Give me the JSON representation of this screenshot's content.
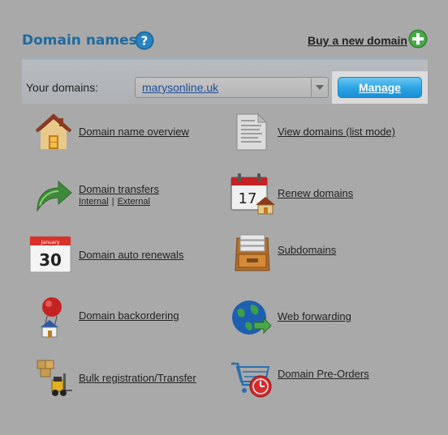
{
  "header": {
    "title": "Domain names",
    "help_icon": "question-mark-icon",
    "buy_link": "Buy a new domain",
    "buy_icon": "plus-circle-icon"
  },
  "domain_bar": {
    "label": "Your domains:",
    "selected_domain": "marysonline.uk",
    "manage_label": "Manage"
  },
  "left_column": [
    {
      "label": "Domain name overview",
      "icon": "house-icon"
    },
    {
      "label": "Domain transfers",
      "icon": "curved-arrow-icon",
      "sublinks": [
        "Internal",
        "External"
      ]
    },
    {
      "label": "Domain auto renewals",
      "icon": "calendar-30-icon",
      "calendar_month": "January",
      "calendar_day": "30"
    },
    {
      "label": "Domain backordering",
      "icon": "balloon-house-icon"
    },
    {
      "label": "Bulk registration/Transfer",
      "icon": "forklift-icon"
    }
  ],
  "right_column": [
    {
      "label": "View domains (list mode)",
      "icon": "document-icon"
    },
    {
      "label": "Renew domains",
      "icon": "calendar-17-icon",
      "calendar_day": "17"
    },
    {
      "label": "Subdomains",
      "icon": "file-drawer-icon"
    },
    {
      "label": "Web forwarding",
      "icon": "globe-arrow-icon"
    },
    {
      "label": "Domain Pre-Orders",
      "icon": "cart-clock-icon"
    }
  ],
  "colors": {
    "background": "#a9a9a9",
    "title": "#1f6aa0",
    "manage_button": "#29a3e3",
    "add_icon": "#3a9a3a"
  }
}
